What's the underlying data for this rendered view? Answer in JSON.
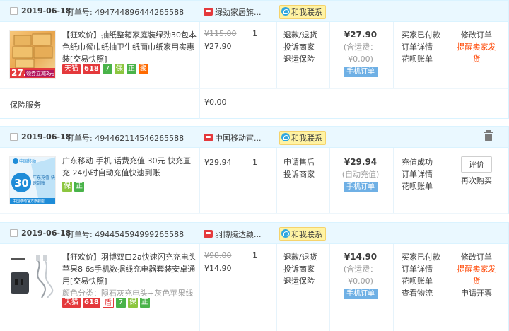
{
  "orders": [
    {
      "date": "2019-06-18",
      "order_no": "订单号: 494744896444265588",
      "shop": "绿劲家居旗...",
      "contact": "和我联系",
      "title_prefix": "【狂欢价】",
      "title": "抽纸整箱家庭装绿劲30包本色纸巾餐巾纸抽卫生纸面巾纸家用实惠装[交易快照]",
      "thumb_text": "27.",
      "thumb_badge": "领券立减2元",
      "badges": [
        "天猫",
        "618",
        "7",
        "保",
        "正",
        "聚"
      ],
      "orig_price": "¥115.00",
      "price": "¥27.90",
      "qty": "1",
      "after_sale": [
        "退款/退货",
        "投诉商家",
        "退运保险"
      ],
      "total": "¥27.90",
      "shipping": "(含运费：¥0.00)",
      "mobile_tag": "手机订单",
      "status": [
        "买家已付款",
        "订单详情",
        "花呗账单"
      ],
      "ops": [
        "修改订单",
        "提醒卖家发货"
      ],
      "service_label": "保险服务",
      "service_price": "¥0.00"
    },
    {
      "date": "2019-06-18",
      "order_no": "订单号: 494462114546265588",
      "shop": "中国移动官...",
      "contact": "和我联系",
      "title": "广东移动 手机 话费充值 30元 快充直充 24小时自动充值快速到账",
      "thumb_top": "中国移动",
      "thumb_num": "30",
      "thumb_desc": "广东充值 快速到账",
      "thumb_bottom": "中国移动官方旗舰店",
      "badges": [
        "保",
        "正"
      ],
      "price": "¥29.94",
      "qty": "1",
      "after_sale": [
        "申请售后",
        "投诉商家"
      ],
      "total": "¥29.94",
      "shipping": "(自动充值)",
      "mobile_tag": "手机订单",
      "status": [
        "充值成功",
        "订单详情",
        "花呗账单"
      ],
      "eval_btn": "评价",
      "ops": [
        "再次购买"
      ]
    },
    {
      "date": "2019-06-18",
      "order_no": "订单号: 494454594999265588",
      "shop": "羽博腾达颖...",
      "contact": "和我联系",
      "title_prefix": "【狂欢价】",
      "title": "羽博双口2a快速闪充充电头苹果8 6s手机数据线充电器套装安卓通用[交易快照]",
      "sku": "颜色分类：陨石灰充电头+灰色苹果线",
      "badges": [
        "天猫",
        "618",
        "盾",
        "7",
        "保",
        "正"
      ],
      "orig_price": "¥98.00",
      "price": "¥14.90",
      "qty": "1",
      "after_sale": [
        "退款/退货",
        "投诉商家",
        "退运保险"
      ],
      "total": "¥14.90",
      "shipping": "(含运费：¥0.00)",
      "mobile_tag": "手机订单",
      "status": [
        "买家已付款",
        "订单详情",
        "花呗账单",
        "查看物流"
      ],
      "ops": [
        "修改订单",
        "提醒卖家发货",
        "申请开票"
      ]
    }
  ],
  "colors": {
    "header_bg": "#eaf8ff",
    "accent_red": "#f40",
    "mobile_tag": "#6fb0e5",
    "tmall_red": "#e4393c"
  }
}
